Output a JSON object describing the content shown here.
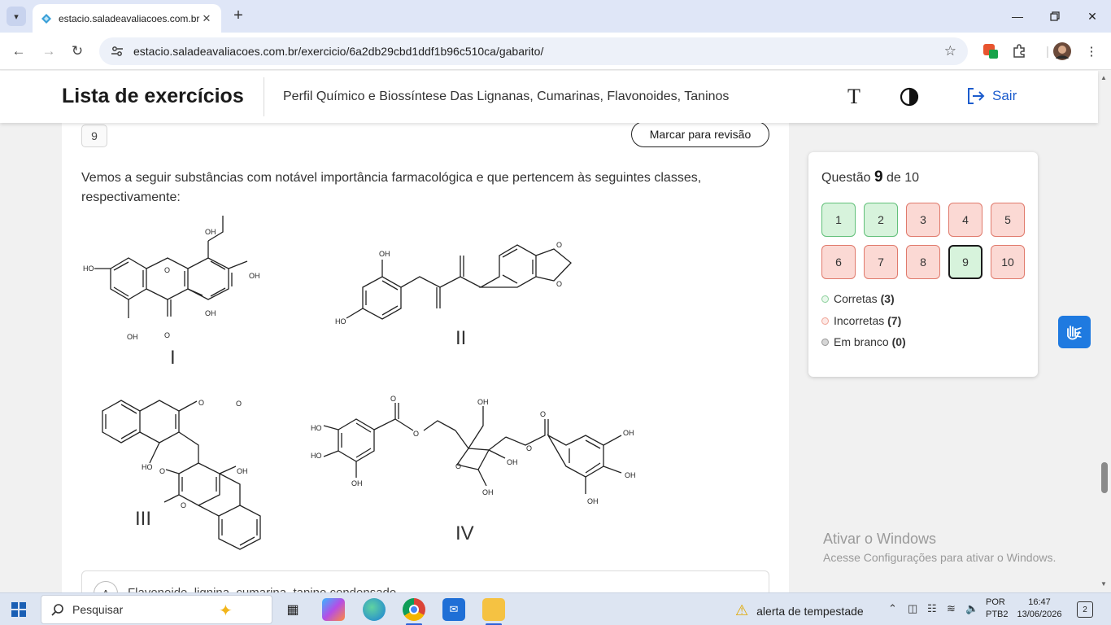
{
  "browser": {
    "tab_title": "estacio.saladeavaliacoes.com.br",
    "url": "estacio.saladeavaliacoes.com.br/exercicio/6a2db29cbd1ddf1b96c510ca/gabarito/"
  },
  "header": {
    "title": "Lista de exercícios",
    "subject": "Perfil Químico e Biossíntese Das Lignanas, Cumarinas, Flavonoides, Taninos",
    "exit_label": "Sair",
    "font_icon": "T"
  },
  "question": {
    "number": "9",
    "review_label": "Marcar para revisão",
    "text": "Vemos a seguir substâncias com notável importância farmacológica e que pertencem às seguintes classes, respectivamente:",
    "structures": [
      {
        "label": "I",
        "atoms": [
          "OH",
          "OH",
          "HO",
          "O",
          "OH",
          "OH",
          "O"
        ]
      },
      {
        "label": "II",
        "atoms": [
          "OH",
          "HO",
          "O",
          "O"
        ]
      },
      {
        "label": "III",
        "atoms": [
          "O",
          "O",
          "HO",
          "O",
          "OH",
          "O"
        ]
      },
      {
        "label": "IV",
        "atoms": [
          "O",
          "HO",
          "HO",
          "O",
          "OH",
          "OH",
          "O",
          "O",
          "OH",
          "OH",
          "OH",
          "OH",
          "OH",
          "O"
        ]
      }
    ],
    "first_alternative": {
      "letter": "A",
      "text": "Flavonoide, lignina, cumarina, tanino condensado"
    }
  },
  "navigation": {
    "label_prefix": "Questão",
    "current": "9",
    "label_suffix": "de 10",
    "questions": [
      {
        "n": "1",
        "status": "correct"
      },
      {
        "n": "2",
        "status": "correct"
      },
      {
        "n": "3",
        "status": "incorrect"
      },
      {
        "n": "4",
        "status": "incorrect"
      },
      {
        "n": "5",
        "status": "incorrect"
      },
      {
        "n": "6",
        "status": "incorrect"
      },
      {
        "n": "7",
        "status": "incorrect"
      },
      {
        "n": "8",
        "status": "incorrect"
      },
      {
        "n": "9",
        "status": "correct"
      },
      {
        "n": "10",
        "status": "incorrect"
      }
    ],
    "legend": [
      {
        "label": "Corretas",
        "count": "(3)",
        "color": "#8fd19e"
      },
      {
        "label": "Incorretas",
        "count": "(7)",
        "color": "#f0a598"
      },
      {
        "label": "Em branco",
        "count": "(0)",
        "color": "#bdbdbd"
      }
    ]
  },
  "watermark": {
    "line1": "Ativar o Windows",
    "line2": "Acesse Configurações para ativar o Windows."
  },
  "taskbar": {
    "search_label": "Pesquisar",
    "weather_label": "alerta de tempestade",
    "lang_line1": "POR",
    "lang_line2": "PTB2",
    "time": "16:47",
    "date": "13/06/2026",
    "notifications": "2"
  },
  "colors": {
    "accent": "#1c5ccd",
    "correct_bg": "#d7f3dc",
    "incorrect_bg": "#fbd9d4"
  }
}
